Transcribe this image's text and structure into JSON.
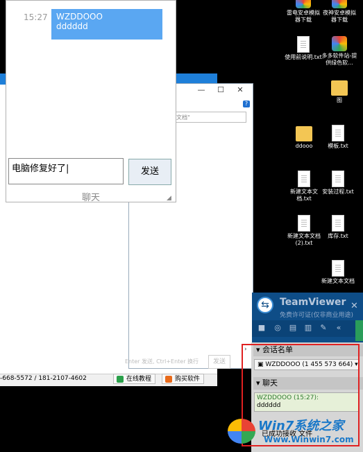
{
  "chat": {
    "timestamp": "15:27",
    "bubble_sender": "WZDDOOO",
    "bubble_message": "dddddd",
    "input_value": "电脑修复好了",
    "send_label": "发送",
    "footer_label": "聊天"
  },
  "explorer": {
    "search_placeholder": "文档\"",
    "statusbar_phone": "-668-5572 / 181-2107-4602",
    "online_tutorial": "在线教程",
    "buy_software": "购买软件",
    "hint": "Enter 发送, Ctrl+Enter 换行",
    "ghost_send": "发送"
  },
  "desktop": {
    "icons": [
      {
        "label": "雷电安卓模拟器下载",
        "icon": "app-icon"
      },
      {
        "label": "夜神安卓模拟器下载",
        "icon": "app-icon"
      },
      {
        "label": "使用前说明.txt",
        "icon": "text-file-icon"
      },
      {
        "label": "多多软件站-提供绿色软...",
        "icon": "app-icon"
      },
      {
        "label": "图",
        "icon": "folder-icon"
      },
      {
        "label": "ddooo",
        "icon": "folder-icon"
      },
      {
        "label": "模板.txt",
        "icon": "text-file-icon"
      },
      {
        "label": "新建文本文档.txt",
        "icon": "text-file-icon"
      },
      {
        "label": "安装过程.txt",
        "icon": "text-file-icon"
      },
      {
        "label": "新建文本文档 (2).txt",
        "icon": "text-file-icon"
      },
      {
        "label": "库存.txt",
        "icon": "text-file-icon"
      },
      {
        "label": "新建文本文档",
        "icon": "text-file-icon"
      }
    ]
  },
  "teamviewer": {
    "title": "TeamViewer",
    "subtitle": "免费许可证(仅非商业用途)",
    "session_header": "会话名单",
    "session_entry": "WZDDOOO (1 455 573 664)",
    "chat_header": "聊天",
    "chat_log_name": "WZDDOOO (15:27):",
    "chat_log_message": "dddddd",
    "status": "已成功接收 文件"
  },
  "watermark": {
    "brand": "Win7系统之家",
    "url": "Www.Winwin7.com"
  },
  "colors": {
    "bubble": "#5aa7f2",
    "teamviewer_blue": "#0e4d87",
    "highlight_red": "#e02020"
  }
}
